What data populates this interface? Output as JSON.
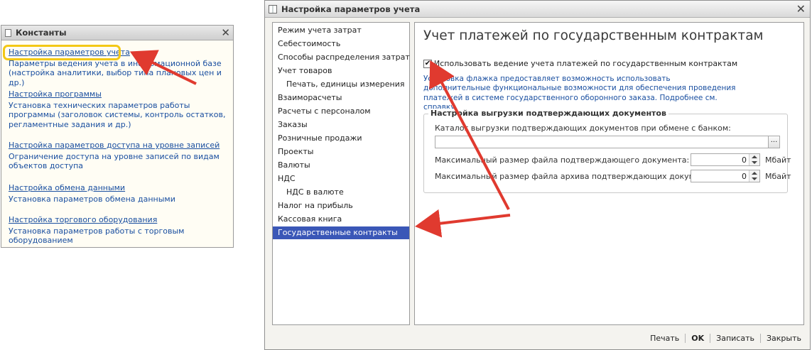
{
  "constants_window": {
    "title": "Константы",
    "items": [
      {
        "link": "Настройка параметров учета",
        "desc": "Параметры ведения учета в информационной базе (настройка аналитики, выбор типа плановых цен и др.)"
      },
      {
        "link": "Настройка программы",
        "desc": "Установка технических параметров работы программы (заголовок системы, контроль остатков, регламентные задания и др.)"
      },
      {
        "link": "Настройка параметров доступа на уровне записей",
        "desc": "Ограничение доступа на уровне записей по видам объектов доступа"
      },
      {
        "link": "Настройка обмена данными",
        "desc": "Установка параметров обмена данными"
      },
      {
        "link": "Настройка торгового оборудования",
        "desc": "Установка параметров работы с торговым оборудованием"
      }
    ]
  },
  "settings_window": {
    "title": "Настройка параметров учета",
    "nav_items": [
      {
        "label": "Режим учета затрат",
        "sub": false,
        "selected": false
      },
      {
        "label": "Себестоимость",
        "sub": false,
        "selected": false
      },
      {
        "label": "Способы распределения затрат",
        "sub": false,
        "selected": false
      },
      {
        "label": "Учет товаров",
        "sub": false,
        "selected": false
      },
      {
        "label": "Печать, единицы измерения",
        "sub": true,
        "selected": false
      },
      {
        "label": "Взаиморасчеты",
        "sub": false,
        "selected": false
      },
      {
        "label": "Расчеты с персоналом",
        "sub": false,
        "selected": false
      },
      {
        "label": "Заказы",
        "sub": false,
        "selected": false
      },
      {
        "label": "Розничные продажи",
        "sub": false,
        "selected": false
      },
      {
        "label": "Проекты",
        "sub": false,
        "selected": false
      },
      {
        "label": "Валюты",
        "sub": false,
        "selected": false
      },
      {
        "label": "НДС",
        "sub": false,
        "selected": false
      },
      {
        "label": "НДС в валюте",
        "sub": true,
        "selected": false
      },
      {
        "label": "Налог на прибыль",
        "sub": false,
        "selected": false
      },
      {
        "label": "Кассовая книга",
        "sub": false,
        "selected": false
      },
      {
        "label": "Государственные контракты",
        "sub": false,
        "selected": true
      }
    ],
    "content": {
      "heading": "Учет платежей по государственным контрактам",
      "checkbox_label": "Использовать ведение учета платежей по государственным контрактам",
      "checkbox_checked": true,
      "info_text": "Установка флажка предоставляет возможность использовать дополнительные функциональные возможности для обеспечения проведения платежей в системе государственного оборонного заказа. Подробнее см. справку.",
      "group": {
        "legend": "Настройка выгрузки подтверждающих документов",
        "catalog_label": "Каталог выгрузки подтверждающих документов при обмене с банком:",
        "catalog_value": "",
        "browse_label": "...",
        "max_file_label": "Максимальный размер файла подтверждающего документа:",
        "max_file_value": "0",
        "max_archive_label": "Максимальный размер файла архива подтверждающих документов:",
        "max_archive_value": "0",
        "unit": "Мбайт"
      }
    },
    "footer": {
      "print": "Печать",
      "ok": "OK",
      "save": "Записать",
      "close": "Закрыть"
    }
  },
  "colors": {
    "link": "#1a4fa0",
    "selection": "#3a57b7",
    "highlight": "#f3c815",
    "arrow": "#e03a2f"
  }
}
